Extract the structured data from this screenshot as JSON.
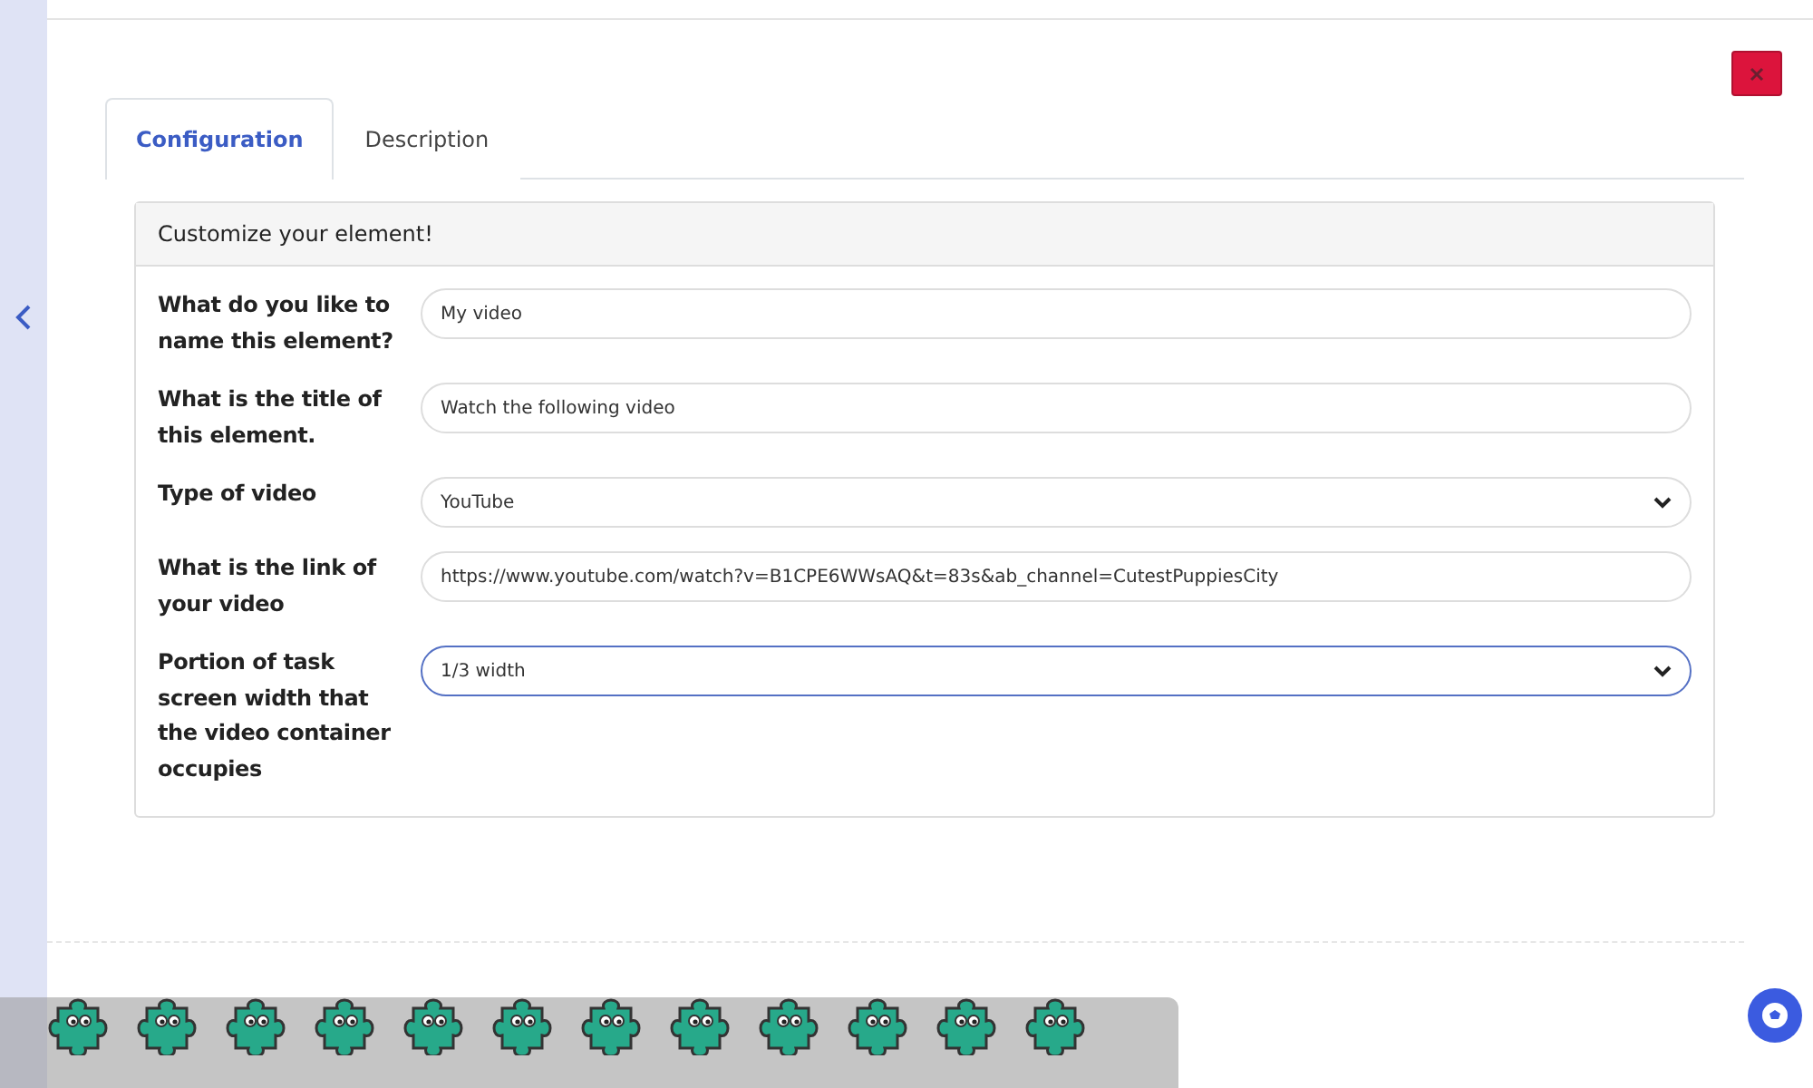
{
  "tabs": [
    {
      "label": "Configuration",
      "selected": true
    },
    {
      "label": "Description",
      "selected": false
    }
  ],
  "panel": {
    "title": "Customize your element!",
    "fields": [
      {
        "label": "What do you like to name this element?",
        "kind": "input",
        "value": "My video",
        "focused": false
      },
      {
        "label": "What is the title of this element.",
        "kind": "input",
        "value": "Watch the following video",
        "focused": false
      },
      {
        "label": "Type of video",
        "kind": "select",
        "value": "YouTube",
        "focused": false
      },
      {
        "label": "What is the link of your video",
        "kind": "input",
        "value": "https://www.youtube.com/watch?v=B1CPE6WWsAQ&t=83s&ab_channel=CutestPuppiesCity",
        "focused": false
      },
      {
        "label": "Portion of task screen width that the video container occupies",
        "kind": "select",
        "value": "1/3 width",
        "focused": true
      }
    ]
  },
  "toolbar": {
    "stickers": [
      {
        "kind": "puzzle"
      },
      {
        "kind": "puzzle"
      },
      {
        "kind": "puzzle"
      },
      {
        "kind": "puzzle"
      },
      {
        "kind": "puzzle"
      },
      {
        "kind": "puzzle"
      },
      {
        "kind": "puzzle"
      },
      {
        "kind": "puzzle"
      },
      {
        "kind": "puzzle"
      },
      {
        "kind": "puzzle"
      },
      {
        "kind": "puzzle"
      },
      {
        "kind": "puzzle"
      }
    ]
  }
}
